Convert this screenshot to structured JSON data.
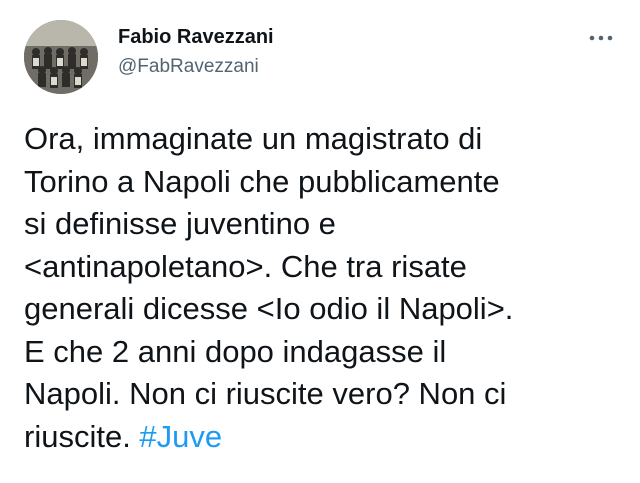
{
  "author": {
    "name": "Fabio Ravezzani",
    "handle": "@FabRavezzani",
    "avatar_icon": "profile-photo-avatar"
  },
  "more_icon": "more-options-icon",
  "colors": {
    "text": "#0f1419",
    "secondary": "#536471",
    "link": "#1d9bf0"
  },
  "tweet": {
    "lines": [
      "Ora, immaginate un magistrato di",
      "Torino a Napoli che pubblicamente",
      "si definisse juventino e",
      "<antinapoletano>. Che tra risate",
      "generali dicesse <Io odio il Napoli>.",
      "E che 2 anni dopo indagasse il",
      "Napoli. Non ci riuscite vero? Non ci",
      "riuscite. "
    ],
    "hashtag": "#Juve"
  }
}
